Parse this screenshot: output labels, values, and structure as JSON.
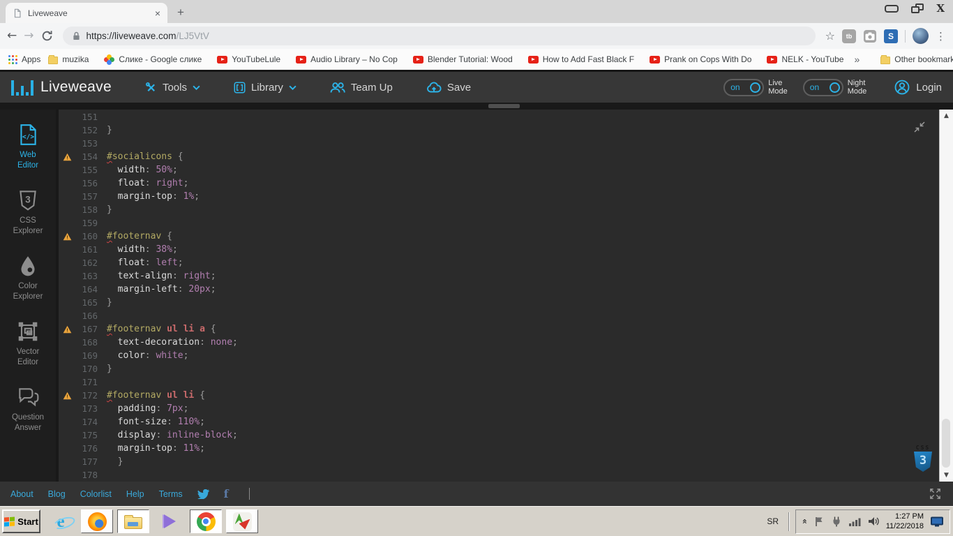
{
  "browser": {
    "tab_title": "Liveweave",
    "newtab_glyph": "+",
    "back_glyph": "←",
    "forward_glyph": "→",
    "url_origin": "https://liveweave.com",
    "url_path": "/LJ5VtV",
    "star_glyph": "☆",
    "menu_glyph": "⋮",
    "extensions": {
      "tb_label": "tb",
      "s_label": "S"
    },
    "bookmarks": {
      "apps_label": "Apps",
      "items": [
        {
          "icon": "folder",
          "label": "muzika"
        },
        {
          "icon": "photos",
          "label": "Слике - Google слике"
        },
        {
          "icon": "youtube",
          "label": "YouTubeLule"
        },
        {
          "icon": "youtube",
          "label": "Audio Library – No Cop"
        },
        {
          "icon": "youtube",
          "label": "Blender Tutorial: Wood"
        },
        {
          "icon": "youtube",
          "label": "How to Add Fast Black F"
        },
        {
          "icon": "youtube",
          "label": "Prank on Cops With Do"
        },
        {
          "icon": "youtube",
          "label": "NELK - YouTube"
        }
      ],
      "overflow_glyph": "»",
      "other_label": "Other bookmarks"
    }
  },
  "header": {
    "brand": "Liveweave",
    "accent_color": "#2cb3e8",
    "menu": [
      {
        "id": "tools",
        "label": "Tools",
        "chevron": true
      },
      {
        "id": "library",
        "label": "Library",
        "chevron": true
      },
      {
        "id": "teamup",
        "label": "Team Up",
        "chevron": false
      },
      {
        "id": "save",
        "label": "Save",
        "chevron": false
      }
    ],
    "toggles": [
      {
        "id": "live-mode",
        "state": "on",
        "line1": "Live",
        "line2": "Mode"
      },
      {
        "id": "night-mode",
        "state": "on",
        "line1": "Night",
        "line2": "Mode"
      }
    ],
    "login_label": "Login"
  },
  "sidebar": [
    {
      "icon": "web-editor",
      "line1": "Web",
      "line2": "Editor",
      "active": true
    },
    {
      "icon": "css-explorer",
      "line1": "CSS",
      "line2": "Explorer",
      "active": false
    },
    {
      "icon": "color-explorer",
      "line1": "Color",
      "line2": "Explorer",
      "active": false
    },
    {
      "icon": "vector-editor",
      "line1": "Vector",
      "line2": "Editor",
      "active": false
    },
    {
      "icon": "question-answer",
      "line1": "Question",
      "line2": "Answer",
      "active": false
    }
  ],
  "editor": {
    "language_badge": "CSS",
    "badge_number": "3",
    "colors": {
      "bg": "#2b2b2b",
      "id": "#b3aa63",
      "tag": "#c96a6b",
      "property": "#dadada",
      "value": "#b27fb0",
      "punct": "#9d9d9d",
      "lineno": "#63676a"
    },
    "lines": [
      {
        "n": "151",
        "w": 0,
        "t": []
      },
      {
        "n": "152",
        "w": 0,
        "t": [
          [
            "p",
            "}"
          ]
        ]
      },
      {
        "n": "153",
        "w": 0,
        "t": []
      },
      {
        "n": "154",
        "w": 1,
        "t": [
          [
            "id",
            "#socialicons"
          ],
          [
            "sp",
            " "
          ],
          [
            "p",
            "{"
          ]
        ]
      },
      {
        "n": "155",
        "w": 0,
        "t": [
          [
            "sp",
            "  "
          ],
          [
            "pr",
            "width"
          ],
          [
            "p",
            ":"
          ],
          [
            "sp",
            " "
          ],
          [
            "v",
            "50%"
          ],
          [
            "p",
            ";"
          ]
        ]
      },
      {
        "n": "156",
        "w": 0,
        "t": [
          [
            "sp",
            "  "
          ],
          [
            "pr",
            "float"
          ],
          [
            "p",
            ":"
          ],
          [
            "sp",
            " "
          ],
          [
            "v",
            "right"
          ],
          [
            "p",
            ";"
          ]
        ]
      },
      {
        "n": "157",
        "w": 0,
        "t": [
          [
            "sp",
            "  "
          ],
          [
            "pr",
            "margin-top"
          ],
          [
            "p",
            ":"
          ],
          [
            "sp",
            " "
          ],
          [
            "v",
            "1%"
          ],
          [
            "p",
            ";"
          ]
        ]
      },
      {
        "n": "158",
        "w": 0,
        "t": [
          [
            "p",
            "}"
          ]
        ]
      },
      {
        "n": "159",
        "w": 0,
        "t": []
      },
      {
        "n": "160",
        "w": 1,
        "t": [
          [
            "id",
            "#footernav"
          ],
          [
            "sp",
            " "
          ],
          [
            "p",
            "{"
          ]
        ]
      },
      {
        "n": "161",
        "w": 0,
        "t": [
          [
            "sp",
            "  "
          ],
          [
            "pr",
            "width"
          ],
          [
            "p",
            ":"
          ],
          [
            "sp",
            " "
          ],
          [
            "v",
            "38%"
          ],
          [
            "p",
            ";"
          ]
        ]
      },
      {
        "n": "162",
        "w": 0,
        "t": [
          [
            "sp",
            "  "
          ],
          [
            "pr",
            "float"
          ],
          [
            "p",
            ":"
          ],
          [
            "sp",
            " "
          ],
          [
            "v",
            "left"
          ],
          [
            "p",
            ";"
          ]
        ]
      },
      {
        "n": "163",
        "w": 0,
        "t": [
          [
            "sp",
            "  "
          ],
          [
            "pr",
            "text-align"
          ],
          [
            "p",
            ":"
          ],
          [
            "sp",
            " "
          ],
          [
            "v",
            "right"
          ],
          [
            "p",
            ";"
          ]
        ]
      },
      {
        "n": "164",
        "w": 0,
        "t": [
          [
            "sp",
            "  "
          ],
          [
            "pr",
            "margin-left"
          ],
          [
            "p",
            ":"
          ],
          [
            "sp",
            " "
          ],
          [
            "v",
            "20px"
          ],
          [
            "p",
            ";"
          ]
        ]
      },
      {
        "n": "165",
        "w": 0,
        "t": [
          [
            "p",
            "}"
          ]
        ]
      },
      {
        "n": "166",
        "w": 0,
        "t": []
      },
      {
        "n": "167",
        "w": 1,
        "t": [
          [
            "id",
            "#footernav"
          ],
          [
            "sp",
            " "
          ],
          [
            "tag",
            "ul"
          ],
          [
            "sp",
            " "
          ],
          [
            "tag",
            "li"
          ],
          [
            "sp",
            " "
          ],
          [
            "tag",
            "a"
          ],
          [
            "sp",
            " "
          ],
          [
            "p",
            "{"
          ]
        ]
      },
      {
        "n": "168",
        "w": 0,
        "t": [
          [
            "sp",
            "  "
          ],
          [
            "pr",
            "text-decoration"
          ],
          [
            "p",
            ":"
          ],
          [
            "sp",
            " "
          ],
          [
            "v",
            "none"
          ],
          [
            "p",
            ";"
          ]
        ]
      },
      {
        "n": "169",
        "w": 0,
        "t": [
          [
            "sp",
            "  "
          ],
          [
            "pr",
            "color"
          ],
          [
            "p",
            ":"
          ],
          [
            "sp",
            " "
          ],
          [
            "v",
            "white"
          ],
          [
            "p",
            ";"
          ]
        ]
      },
      {
        "n": "170",
        "w": 0,
        "t": [
          [
            "p",
            "}"
          ]
        ]
      },
      {
        "n": "171",
        "w": 0,
        "t": []
      },
      {
        "n": "172",
        "w": 1,
        "t": [
          [
            "id",
            "#footernav"
          ],
          [
            "sp",
            " "
          ],
          [
            "tag",
            "ul"
          ],
          [
            "sp",
            " "
          ],
          [
            "tag",
            "li"
          ],
          [
            "sp",
            " "
          ],
          [
            "p",
            "{"
          ]
        ]
      },
      {
        "n": "173",
        "w": 0,
        "t": [
          [
            "sp",
            "  "
          ],
          [
            "pr",
            "padding"
          ],
          [
            "p",
            ":"
          ],
          [
            "sp",
            " "
          ],
          [
            "v",
            "7px"
          ],
          [
            "p",
            ";"
          ]
        ]
      },
      {
        "n": "174",
        "w": 0,
        "t": [
          [
            "sp",
            "  "
          ],
          [
            "pr",
            "font-size"
          ],
          [
            "p",
            ":"
          ],
          [
            "sp",
            " "
          ],
          [
            "v",
            "110%"
          ],
          [
            "p",
            ";"
          ]
        ]
      },
      {
        "n": "175",
        "w": 0,
        "t": [
          [
            "sp",
            "  "
          ],
          [
            "pr",
            "display"
          ],
          [
            "p",
            ":"
          ],
          [
            "sp",
            " "
          ],
          [
            "v",
            "inline-block"
          ],
          [
            "p",
            ";"
          ]
        ]
      },
      {
        "n": "176",
        "w": 0,
        "t": [
          [
            "sp",
            "  "
          ],
          [
            "pr",
            "margin-top"
          ],
          [
            "p",
            ":"
          ],
          [
            "sp",
            " "
          ],
          [
            "v",
            "11%"
          ],
          [
            "p",
            ";"
          ]
        ]
      },
      {
        "n": "177",
        "w": 0,
        "t": [
          [
            "sp",
            "  "
          ],
          [
            "p",
            "}"
          ]
        ]
      },
      {
        "n": "178",
        "w": 0,
        "t": []
      }
    ]
  },
  "footer": {
    "links": [
      "About",
      "Blog",
      "Colorlist",
      "Help",
      "Terms"
    ]
  },
  "taskbar": {
    "start_label": "Start",
    "tray_lang": "SR",
    "tray_chevron": "»",
    "time": "1:27 PM",
    "date": "11/22/2018"
  }
}
